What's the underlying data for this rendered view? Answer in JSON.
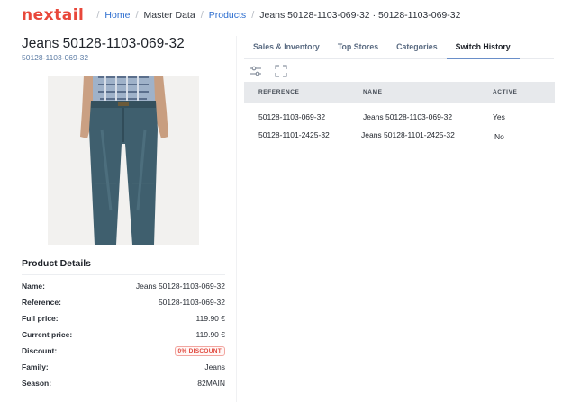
{
  "header": {
    "logo": "nextail",
    "breadcrumb": {
      "home": "Home",
      "master_data": "Master Data",
      "products": "Products",
      "current": "Jeans 50128-1103-069-32 · 50128-1103-069-32",
      "separator": "/"
    }
  },
  "product": {
    "title": "Jeans 50128-1103-069-32",
    "reference": "50128-1103-069-32"
  },
  "details": {
    "title": "Product Details",
    "rows": [
      {
        "label": "Name:",
        "value": "Jeans 50128-1103-069-32"
      },
      {
        "label": "Reference:",
        "value": "50128-1103-069-32"
      },
      {
        "label": "Full price:",
        "value": "119.90 €"
      },
      {
        "label": "Current price:",
        "value": "119.90 €"
      },
      {
        "label": "Discount:",
        "value": "0% DISCOUNT"
      },
      {
        "label": "Family:",
        "value": "Jeans"
      },
      {
        "label": "Season:",
        "value": "82MAIN"
      }
    ]
  },
  "tabs": [
    {
      "label": "Sales & Inventory",
      "active": false
    },
    {
      "label": "Top Stores",
      "active": false
    },
    {
      "label": "Categories",
      "active": false
    },
    {
      "label": "Switch History",
      "active": true
    }
  ],
  "toolbar": {
    "icons": [
      "filter-settings-icon",
      "expand-icon"
    ]
  },
  "history_table": {
    "columns": [
      "REFERENCE",
      "NAME",
      "ACTIVE"
    ],
    "rows": [
      [
        "50128-1103-069-32",
        "Jeans 50128-1103-069-32",
        "Yes"
      ],
      [
        "50128-1101-2425-32",
        "Jeans 50128-1101-2425-32",
        "No"
      ]
    ]
  },
  "colors": {
    "brand": "#e8473a",
    "link": "#2c6dcf",
    "badge": "#e0483d",
    "active_tab_underline": "#6a8fc9"
  }
}
